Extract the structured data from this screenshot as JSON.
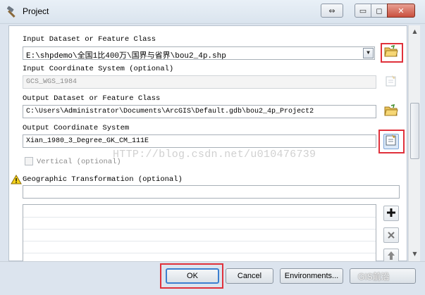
{
  "window": {
    "title": "Project",
    "title_icon": "hammer-icon",
    "swap_label": "⇔",
    "min_label": "▭",
    "max_label": "◻",
    "close_label": "✕"
  },
  "form": {
    "input_dataset": {
      "label": "Input Dataset or Feature Class",
      "value": "E:\\shpdemo\\全国1比400万\\国界与省界\\bou2_4p.shp",
      "browse_icon": "folder-open-icon"
    },
    "input_coord": {
      "label": "Input Coordinate System (optional)",
      "value": "GCS_WGS_1984",
      "browse_icon": "spatial-reference-icon"
    },
    "output_dataset": {
      "label": "Output Dataset or Feature Class",
      "value": "C:\\Users\\Administrator\\Documents\\ArcGIS\\Default.gdb\\bou2_4p_Project2",
      "browse_icon": "folder-open-icon"
    },
    "output_coord": {
      "label": "Output Coordinate System",
      "value": "Xian_1980_3_Degree_GK_CM_111E",
      "browse_icon": "spatial-reference-icon"
    },
    "vertical": {
      "label": "Vertical (optional)"
    },
    "geo_transform": {
      "label": "Geographic Transformation (optional)",
      "value": "",
      "warning_icon": "warning-icon"
    },
    "list_buttons": {
      "add_icon": "plus-icon",
      "remove_icon": "x-icon",
      "up_icon": "arrow-up-icon"
    }
  },
  "watermark": "HTTP://blog.csdn.net/u010476739",
  "footer": {
    "ok_label": "OK",
    "cancel_label": "Cancel",
    "environments_label": "Environments...",
    "watermark": "GIS前沿"
  },
  "colors": {
    "highlight": "#e0313b",
    "frame": "#dce4ee"
  }
}
